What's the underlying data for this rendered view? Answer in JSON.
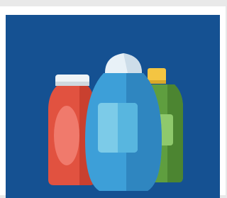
{
  "image": {
    "subject": "bottles-illustration",
    "colors": {
      "background": "#155192",
      "red_bottle": "#e15240",
      "red_bottle_shade": "#c9402f",
      "red_label": "#f07a6c",
      "blue_bottle": "#3d9fd8",
      "blue_bottle_shade": "#2f86c0",
      "blue_label": "#7ccbe8",
      "blue_cap": "#e8f1f7",
      "green_bottle": "#5f9e3f",
      "green_bottle_shade": "#4c8531",
      "green_label": "#8fc96c",
      "yellow_cap": "#f4c542",
      "white_cap": "#eef3f6"
    }
  }
}
